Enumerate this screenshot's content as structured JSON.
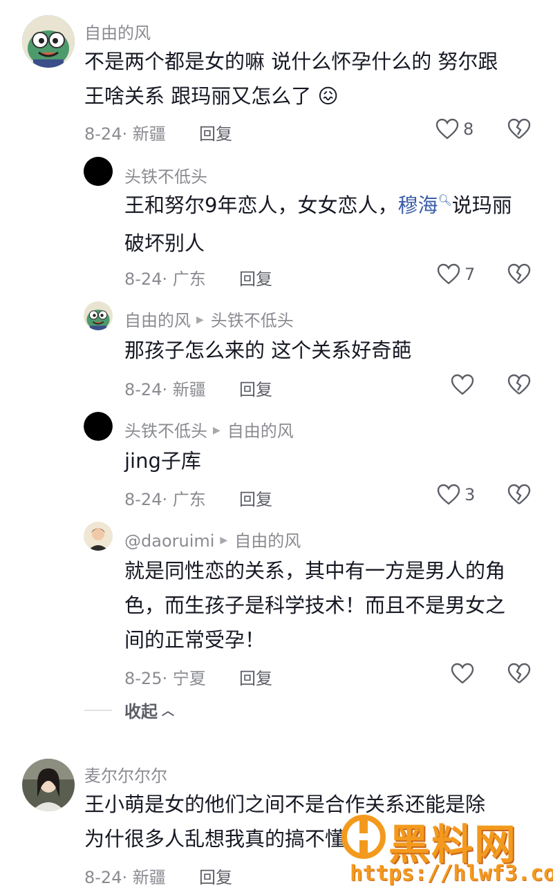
{
  "colors": {
    "accent_mention": "#3b5ea8",
    "text": "#161823",
    "meta": "#8a8b91",
    "watermark": "#f39a1e"
  },
  "comments": [
    {
      "author": "自由的风",
      "lines": [
        "不是两个都是女的嘛 说什么怀孕什么的 努尔跟",
        "王啥关系 跟玛丽又怎么了"
      ],
      "emoji": "😖",
      "date": "8-24",
      "location": "新疆",
      "reply_label": "回复",
      "likes": "8",
      "avatar_icon": "cartoon-frog-avatar-icon"
    },
    {
      "author": "头铁不低头",
      "lines_pre": "王和努尔9年恋人，女女恋人，",
      "mention": "穆海",
      "lines_post": "说玛丽",
      "line2": "破坏别人",
      "date": "8-24",
      "location": "广东",
      "reply_label": "回复",
      "likes": "7",
      "avatar_icon": "black-circle-avatar-icon"
    },
    {
      "author": "自由的风",
      "reply_to": "头铁不低头",
      "line1": "那孩子怎么来的 这个关系好奇葩",
      "date": "8-24",
      "location": "新疆",
      "reply_label": "回复",
      "likes": "",
      "avatar_icon": "cartoon-frog-avatar-icon"
    },
    {
      "author": "头铁不低头",
      "reply_to": "自由的风",
      "line1": "jing子库",
      "date": "8-24",
      "location": "广东",
      "reply_label": "回复",
      "likes": "3",
      "avatar_icon": "black-circle-avatar-icon"
    },
    {
      "author": "@daoruimi",
      "reply_to": "自由的风",
      "lines": [
        "就是同性恋的关系，其中有一方是男人的角",
        "色，而生孩子是科学技术！而且不是男女之",
        "间的正常受孕！"
      ],
      "date": "8-25",
      "location": "宁夏",
      "reply_label": "回复",
      "likes": "",
      "avatar_icon": "person-photo-avatar-icon"
    },
    {
      "author": "麦尔尔尔尔",
      "lines": [
        "王小萌是女的他们之间不是合作关系还能是除",
        "为什很多人乱想我真的搞不懂"
      ],
      "date": "8-24",
      "location": "新疆",
      "reply_label": "回复",
      "avatar_icon": "woman-photo-avatar-icon"
    }
  ],
  "collapse_label": "收起",
  "watermark": {
    "logo": "黑料网",
    "url": "https://hlwf3.com"
  }
}
